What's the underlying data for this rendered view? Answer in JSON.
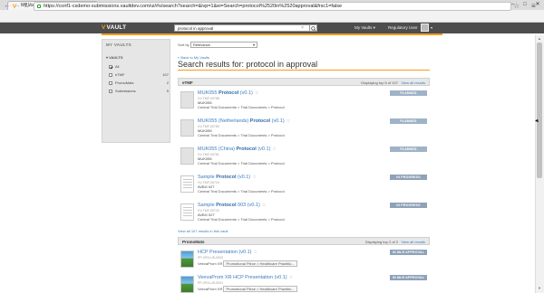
{
  "browser": {
    "tab_title": "My Vaults",
    "tab_close": "×",
    "url": "https://conf1-csdemo-submissions.vaultdev.com/ui/#s/search?search=&ivp=1&ei=Search=protocol%2520in%2520approval&frsc1=false",
    "window_controls": {
      "minimize": "─",
      "maximize": "□",
      "close": "✕"
    }
  },
  "header": {
    "logo_mark": "V",
    "logo_text": "VAULT",
    "search_value": "protocol in approval",
    "search_clear": "×",
    "my_vaults": "My Vaults ▾",
    "user_label": "Regulatory User",
    "user_caret": "▾"
  },
  "sidebar": {
    "title": "MY VAULTS",
    "section": "▾ VAULTS",
    "items": [
      {
        "label": "All",
        "count": "",
        "checked": true
      },
      {
        "label": "eTMF",
        "count": "107",
        "checked": false
      },
      {
        "label": "PromoMats",
        "count": "2",
        "checked": false
      },
      {
        "label": "Submissions",
        "count": "5",
        "checked": false
      }
    ]
  },
  "main": {
    "sort_label": "Sort by",
    "sort_value": "Relevance",
    "back_link": "« Back to My Vaults",
    "page_title": "Search results for: protocol in approval",
    "groups": [
      {
        "name": "eTMF",
        "displaying": "Displaying top 5 of 107",
        "view_all": "View all results",
        "results": [
          {
            "title_prefix": "MUK055 ",
            "title_bold": "Protocol",
            "title_suffix": " (v0.1)",
            "star": "☆",
            "number": "VV-TMF-00758",
            "line3": "MUK055",
            "line4": "Central Trial Documents > Trial Documents > Protocol",
            "status": "PLANNED",
            "thumb": "blank"
          },
          {
            "title_prefix": "MUK055 (Netherlands) ",
            "title_bold": "Protocol",
            "title_suffix": " (v0.1)",
            "star": "☆",
            "number": "VV-TMF-00759",
            "line3": "MUK055",
            "line4": "Central Trial Documents > Trial Documents > Protocol",
            "status": "PLANNED",
            "thumb": "blank"
          },
          {
            "title_prefix": "MUK055 (China) ",
            "title_bold": "Protocol",
            "title_suffix": " (v0.1)",
            "star": "☆",
            "number": "VV-TMF-00761",
            "line3": "MUK055",
            "line4": "Central Trial Documents > Trial Documents > Protocol",
            "status": "PLANNED",
            "thumb": "blank"
          },
          {
            "title_prefix": "Sample ",
            "title_bold": "Protocol",
            "title_suffix": " (v0.1)",
            "star": "☆",
            "number": "VV-TMF-00719",
            "line3": "AVBG 027",
            "line4": "Central Trial Documents > Trial Documents > Protocol",
            "status": "IN PROGRESS",
            "thumb": "doc"
          },
          {
            "title_prefix": "Sample ",
            "title_bold": "Protocol",
            "title_suffix": " 003 (v0.1)",
            "star": "☆",
            "number": "VV-TMF-00723",
            "line3": "AVBG 027",
            "line4": "Central Trial Documents > Trial Documents > Protocol",
            "status": "IN PROGRESS",
            "thumb": "doc"
          }
        ],
        "footer_link": "View all 107 results in this vault"
      },
      {
        "name": "PromoMats",
        "displaying": "Displaying top 2 of 2",
        "view_all": "View all results",
        "results": [
          {
            "title_prefix": "HCP Presentation (v0.1)",
            "title_bold": "",
            "title_suffix": "",
            "star": "☆",
            "number": "PP-VRX-US-0002",
            "line3": "",
            "line4_tags": [
              "VeevaProm XR",
              "Promotional Piece > Healthcare Practitio..."
            ],
            "status": "IN MLR APPROVAL",
            "thumb": "img"
          },
          {
            "title_prefix": "VeevaProm XR HCP Presentation (v0.1)",
            "title_bold": "",
            "title_suffix": "",
            "star": "☆",
            "number": "PP-VRX-US-0001",
            "line3": "",
            "line4_tags": [
              "VeevaProm XR",
              "Promotional Piece > Healthcare Practitio..."
            ],
            "status": "IN MLR APPROVAL",
            "thumb": "img"
          }
        ]
      }
    ]
  }
}
